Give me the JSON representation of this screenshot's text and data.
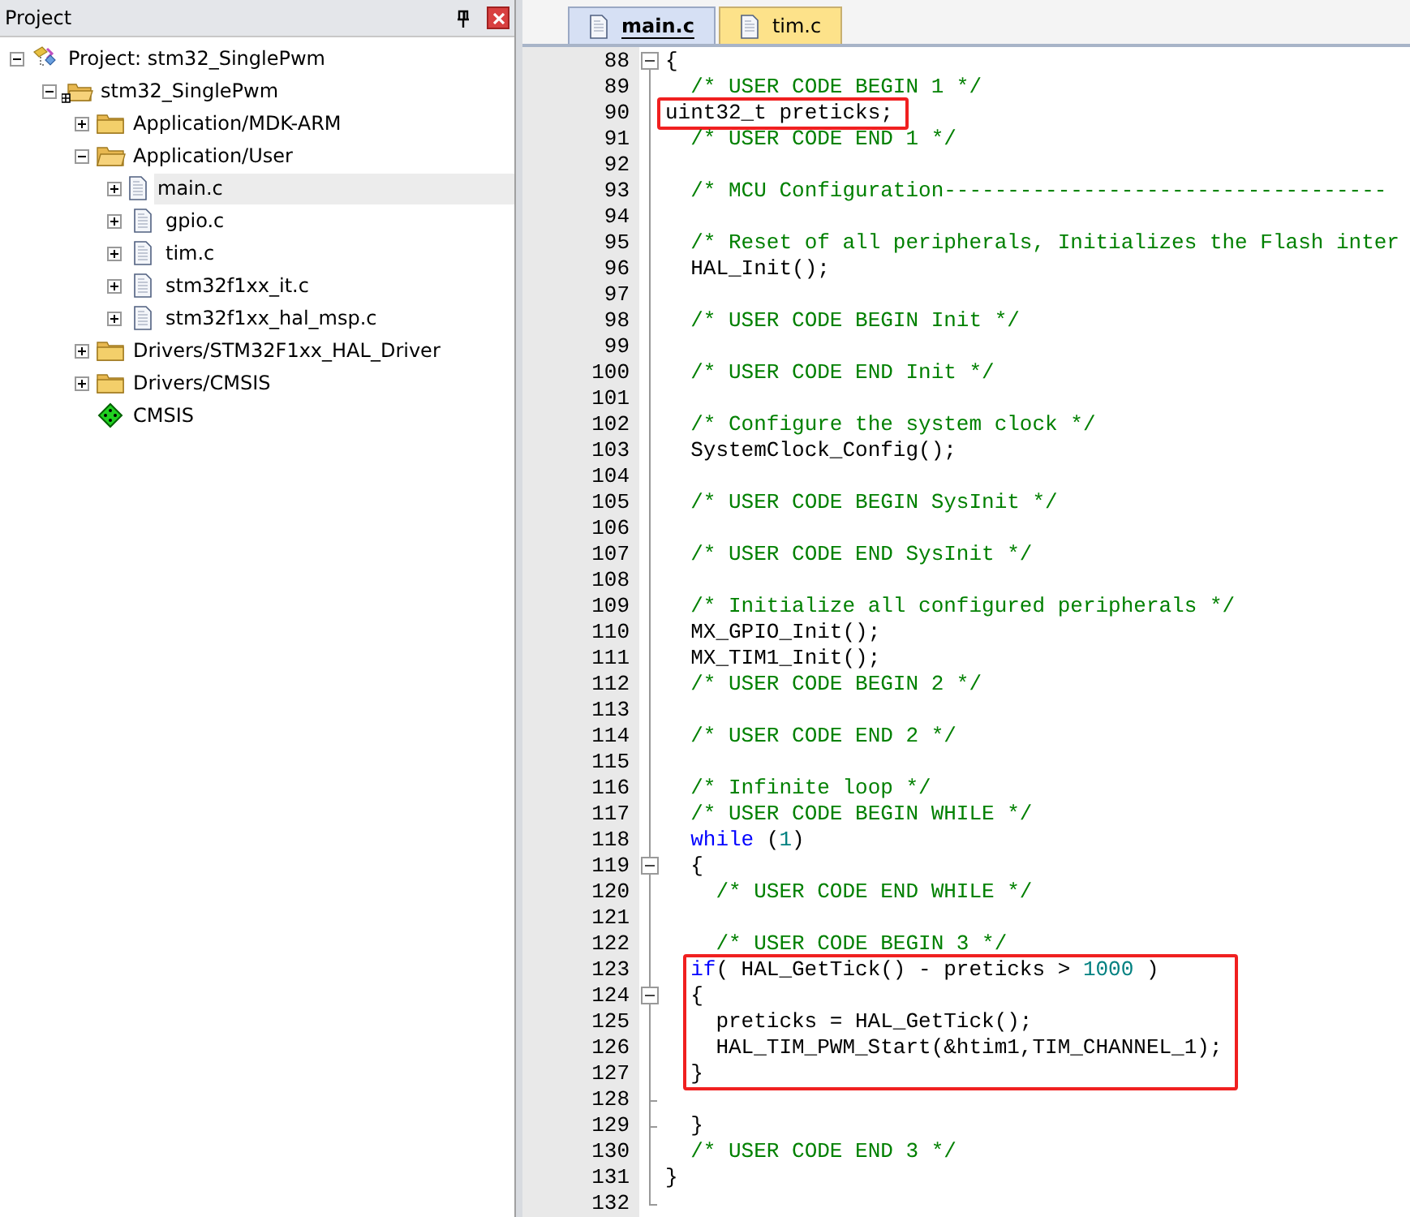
{
  "project_panel": {
    "title": "Project",
    "tree": [
      {
        "label": "Project: stm32_SinglePwm",
        "kind": "project",
        "expanded": true,
        "selected": false,
        "children": [
          {
            "label": "stm32_SinglePwm",
            "kind": "target",
            "expanded": true,
            "selected": false,
            "children": [
              {
                "label": "Application/MDK-ARM",
                "kind": "group",
                "expanded": false,
                "selected": false
              },
              {
                "label": "Application/User",
                "kind": "group",
                "expanded": true,
                "selected": false,
                "children": [
                  {
                    "label": "main.c",
                    "kind": "file",
                    "expanded": false,
                    "selected": true
                  },
                  {
                    "label": "gpio.c",
                    "kind": "file",
                    "expanded": false,
                    "selected": false
                  },
                  {
                    "label": "tim.c",
                    "kind": "file",
                    "expanded": false,
                    "selected": false
                  },
                  {
                    "label": "stm32f1xx_it.c",
                    "kind": "file",
                    "expanded": false,
                    "selected": false
                  },
                  {
                    "label": "stm32f1xx_hal_msp.c",
                    "kind": "file",
                    "expanded": false,
                    "selected": false
                  }
                ]
              },
              {
                "label": "Drivers/STM32F1xx_HAL_Driver",
                "kind": "group",
                "expanded": false,
                "selected": false
              },
              {
                "label": "Drivers/CMSIS",
                "kind": "group",
                "expanded": false,
                "selected": false
              },
              {
                "label": "CMSIS",
                "kind": "component",
                "selected": false
              }
            ]
          }
        ]
      }
    ]
  },
  "editor": {
    "tabs": [
      {
        "label": "main.c",
        "selected": true
      },
      {
        "label": "tim.c",
        "selected": false
      }
    ],
    "lines": [
      {
        "number": "88",
        "fold_start": true,
        "segments": [
          {
            "kind": "plain",
            "text": "{"
          }
        ]
      },
      {
        "number": "89",
        "segments": [
          {
            "kind": "comment",
            "text": "  /* USER CODE BEGIN 1 */"
          }
        ]
      },
      {
        "number": "90",
        "boxed": true,
        "segments": [
          {
            "kind": "plain",
            "text": "uint32_t preticks;"
          }
        ]
      },
      {
        "number": "91",
        "segments": [
          {
            "kind": "comment",
            "text": "  /* USER CODE END 1 */"
          }
        ]
      },
      {
        "number": "92"
      },
      {
        "number": "93",
        "segments": [
          {
            "kind": "comment",
            "text": "  /* MCU Configuration-----------------------------------"
          }
        ]
      },
      {
        "number": "94"
      },
      {
        "number": "95",
        "segments": [
          {
            "kind": "comment",
            "text": "  /* Reset of all peripherals, Initializes the Flash inter"
          }
        ]
      },
      {
        "number": "96",
        "segments": [
          {
            "kind": "plain",
            "text": "  HAL_Init();"
          }
        ]
      },
      {
        "number": "97"
      },
      {
        "number": "98",
        "segments": [
          {
            "kind": "comment",
            "text": "  /* USER CODE BEGIN Init */"
          }
        ]
      },
      {
        "number": "99"
      },
      {
        "number": "100",
        "segments": [
          {
            "kind": "comment",
            "text": "  /* USER CODE END Init */"
          }
        ]
      },
      {
        "number": "101"
      },
      {
        "number": "102",
        "segments": [
          {
            "kind": "comment",
            "text": "  /* Configure the system clock */"
          }
        ]
      },
      {
        "number": "103",
        "segments": [
          {
            "kind": "plain",
            "text": "  SystemClock_Config();"
          }
        ]
      },
      {
        "number": "104"
      },
      {
        "number": "105",
        "segments": [
          {
            "kind": "comment",
            "text": "  /* USER CODE BEGIN SysInit */"
          }
        ]
      },
      {
        "number": "106"
      },
      {
        "number": "107",
        "segments": [
          {
            "kind": "comment",
            "text": "  /* USER CODE END SysInit */"
          }
        ]
      },
      {
        "number": "108"
      },
      {
        "number": "109",
        "segments": [
          {
            "kind": "comment",
            "text": "  /* Initialize all configured peripherals */"
          }
        ]
      },
      {
        "number": "110",
        "segments": [
          {
            "kind": "plain",
            "text": "  MX_GPIO_Init();"
          }
        ]
      },
      {
        "number": "111",
        "segments": [
          {
            "kind": "plain",
            "text": "  MX_TIM1_Init();"
          }
        ]
      },
      {
        "number": "112",
        "segments": [
          {
            "kind": "comment",
            "text": "  /* USER CODE BEGIN 2 */"
          }
        ]
      },
      {
        "number": "113"
      },
      {
        "number": "114",
        "segments": [
          {
            "kind": "comment",
            "text": "  /* USER CODE END 2 */"
          }
        ]
      },
      {
        "number": "115"
      },
      {
        "number": "116",
        "segments": [
          {
            "kind": "comment",
            "text": "  /* Infinite loop */"
          }
        ]
      },
      {
        "number": "117",
        "segments": [
          {
            "kind": "comment",
            "text": "  /* USER CODE BEGIN WHILE */"
          }
        ]
      },
      {
        "number": "118",
        "segments": [
          {
            "kind": "keyword",
            "text": "  while"
          },
          {
            "kind": "plain",
            "text": " ("
          },
          {
            "kind": "number",
            "text": "1"
          },
          {
            "kind": "plain",
            "text": ")"
          }
        ]
      },
      {
        "number": "119",
        "fold_start": true,
        "segments": [
          {
            "kind": "plain",
            "text": "  {"
          }
        ]
      },
      {
        "number": "120",
        "segments": [
          {
            "kind": "comment",
            "text": "    /* USER CODE END WHILE */"
          }
        ]
      },
      {
        "number": "121"
      },
      {
        "number": "122",
        "segments": [
          {
            "kind": "comment",
            "text": "    /* USER CODE BEGIN 3 */"
          }
        ]
      },
      {
        "number": "123",
        "boxed": true,
        "segments": [
          {
            "kind": "keyword",
            "text": "  if"
          },
          {
            "kind": "plain",
            "text": "( HAL_GetTick() - preticks > "
          },
          {
            "kind": "number",
            "text": "1000"
          },
          {
            "kind": "plain",
            "text": " )"
          }
        ]
      },
      {
        "number": "124",
        "fold_start": true,
        "boxed": true,
        "segments": [
          {
            "kind": "plain",
            "text": "  {"
          }
        ]
      },
      {
        "number": "125",
        "boxed": true,
        "segments": [
          {
            "kind": "plain",
            "text": "    preticks = HAL_GetTick();"
          }
        ]
      },
      {
        "number": "126",
        "boxed": true,
        "segments": [
          {
            "kind": "plain",
            "text": "    HAL_TIM_PWM_Start(&htim1,TIM_CHANNEL_1);"
          }
        ]
      },
      {
        "number": "127",
        "boxed": true,
        "segments": [
          {
            "kind": "plain",
            "text": "  }"
          }
        ]
      },
      {
        "number": "128",
        "fold_end": true
      },
      {
        "number": "129",
        "fold_end": true,
        "segments": [
          {
            "kind": "plain",
            "text": "  }"
          }
        ]
      },
      {
        "number": "130",
        "segments": [
          {
            "kind": "comment",
            "text": "  /* USER CODE END 3 */"
          }
        ]
      },
      {
        "number": "131",
        "segments": [
          {
            "kind": "plain",
            "text": "}"
          }
        ]
      },
      {
        "number": "132",
        "fold_end": true
      }
    ]
  }
}
